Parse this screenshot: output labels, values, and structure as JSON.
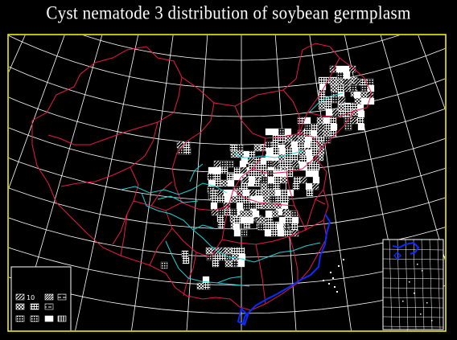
{
  "title": "Cyst nematode 3 distribution of soybean germplasm",
  "colors": {
    "background": "#000000",
    "frame": "#ffff00",
    "graticule": "#ffffff",
    "boundaries": "#e8194a",
    "rivers": "#22d3d3",
    "coastline": "#0a2cff",
    "germplasm_cells": "#ffffff"
  },
  "legend": {
    "entries": [
      {
        "label": "10",
        "pattern": "hatch"
      },
      {
        "label": "",
        "pattern": "hatch-dense"
      },
      {
        "label": "",
        "pattern": "dash"
      },
      {
        "label": "",
        "pattern": "cross"
      },
      {
        "label": "",
        "pattern": "grid"
      },
      {
        "label": "",
        "pattern": "dash-dense"
      },
      {
        "label": "",
        "pattern": "dots"
      },
      {
        "label": "",
        "pattern": "dots-dash"
      },
      {
        "label": "",
        "pattern": "solid"
      },
      {
        "label": "",
        "pattern": "bars"
      }
    ]
  },
  "inset": {
    "name": "south-china-sea-inset"
  }
}
